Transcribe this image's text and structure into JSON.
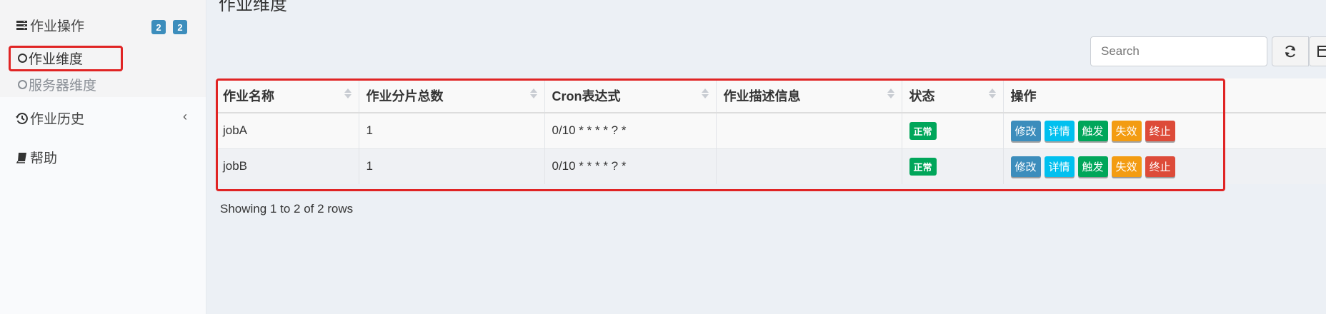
{
  "page": {
    "title": "作业维度"
  },
  "sidebar": {
    "job_ops": {
      "label": "作业操作",
      "icon": "server-icon",
      "badges": [
        "2",
        "2"
      ]
    },
    "sub_items": [
      {
        "label": "作业维度",
        "icon": "circle-outline-icon",
        "active": true
      },
      {
        "label": "服务器维度",
        "icon": "circle-outline-icon",
        "active": false
      }
    ],
    "job_history": {
      "label": "作业历史",
      "icon": "history-icon"
    },
    "help": {
      "label": "帮助",
      "icon": "book-icon"
    }
  },
  "toolbar": {
    "search_placeholder": "Search",
    "refresh_icon": "refresh-icon",
    "columns_icon": "columns-icon"
  },
  "table": {
    "columns": [
      "作业名称",
      "作业分片总数",
      "Cron表达式",
      "作业描述信息",
      "状态",
      "操作"
    ],
    "rows": [
      {
        "name": "jobA",
        "shards": "1",
        "cron": "0/10 * * * * ? *",
        "desc": "",
        "status": "正常"
      },
      {
        "name": "jobB",
        "shards": "1",
        "cron": "0/10 * * * * ? *",
        "desc": "",
        "status": "正常"
      }
    ],
    "actions": [
      "修改",
      "详情",
      "触发",
      "失效",
      "终止"
    ]
  },
  "pagination": {
    "summary": "Showing 1 to 2 of 2 rows"
  },
  "colors": {
    "primary": "#3c8dbc",
    "info": "#00c0ef",
    "success": "#00a65a",
    "warning": "#f39c12",
    "danger": "#dd4b39",
    "highlight": "#e02424"
  }
}
